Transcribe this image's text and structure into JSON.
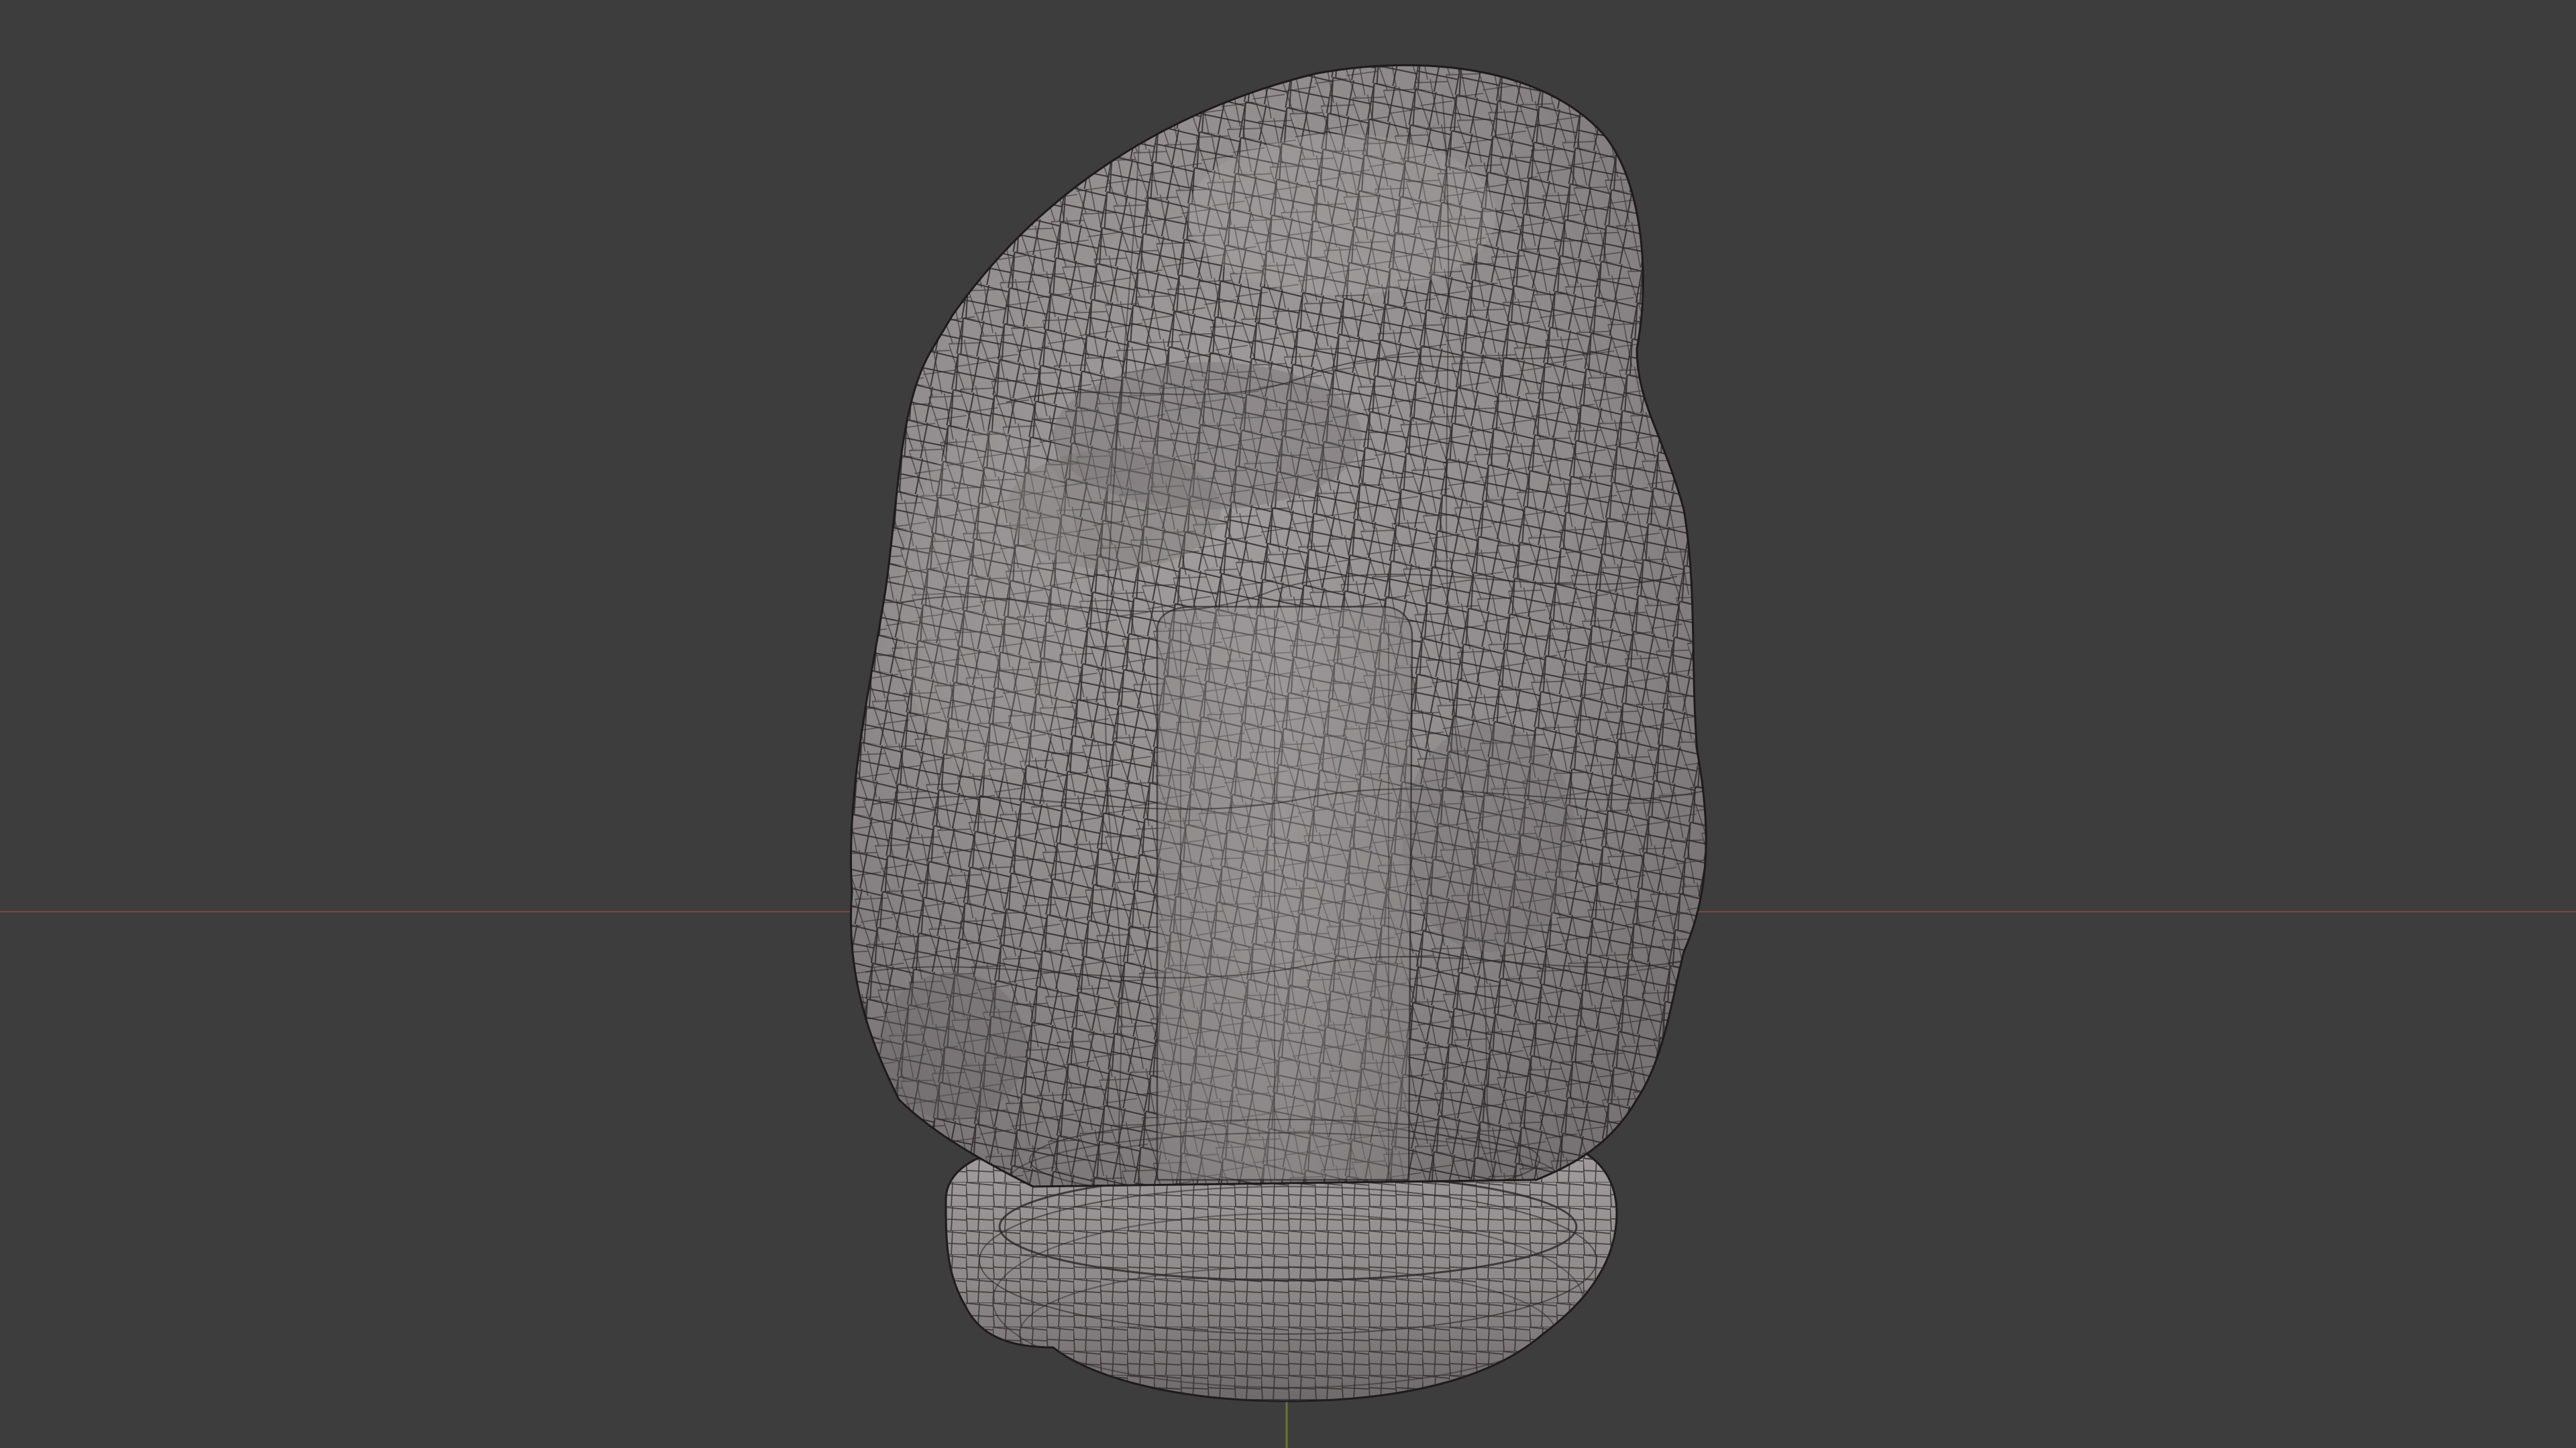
{
  "viewport": {
    "background_color": "#3d3d3d",
    "grid_axis_x_color": "#8a4a45",
    "grid_axis_z_color": "#6d7f2c",
    "mesh_fill_color": "#8f8a8b",
    "mesh_shadow_color": "#6f6a6c",
    "mesh_highlight_color": "#aaa5a6",
    "wireframe_color": "#2a2627",
    "objects": [
      {
        "name": "rock-mesh",
        "type": "sculpted-rock"
      },
      {
        "name": "inner-cylinder",
        "type": "cylinder"
      },
      {
        "name": "base-torus",
        "type": "torus"
      }
    ]
  }
}
